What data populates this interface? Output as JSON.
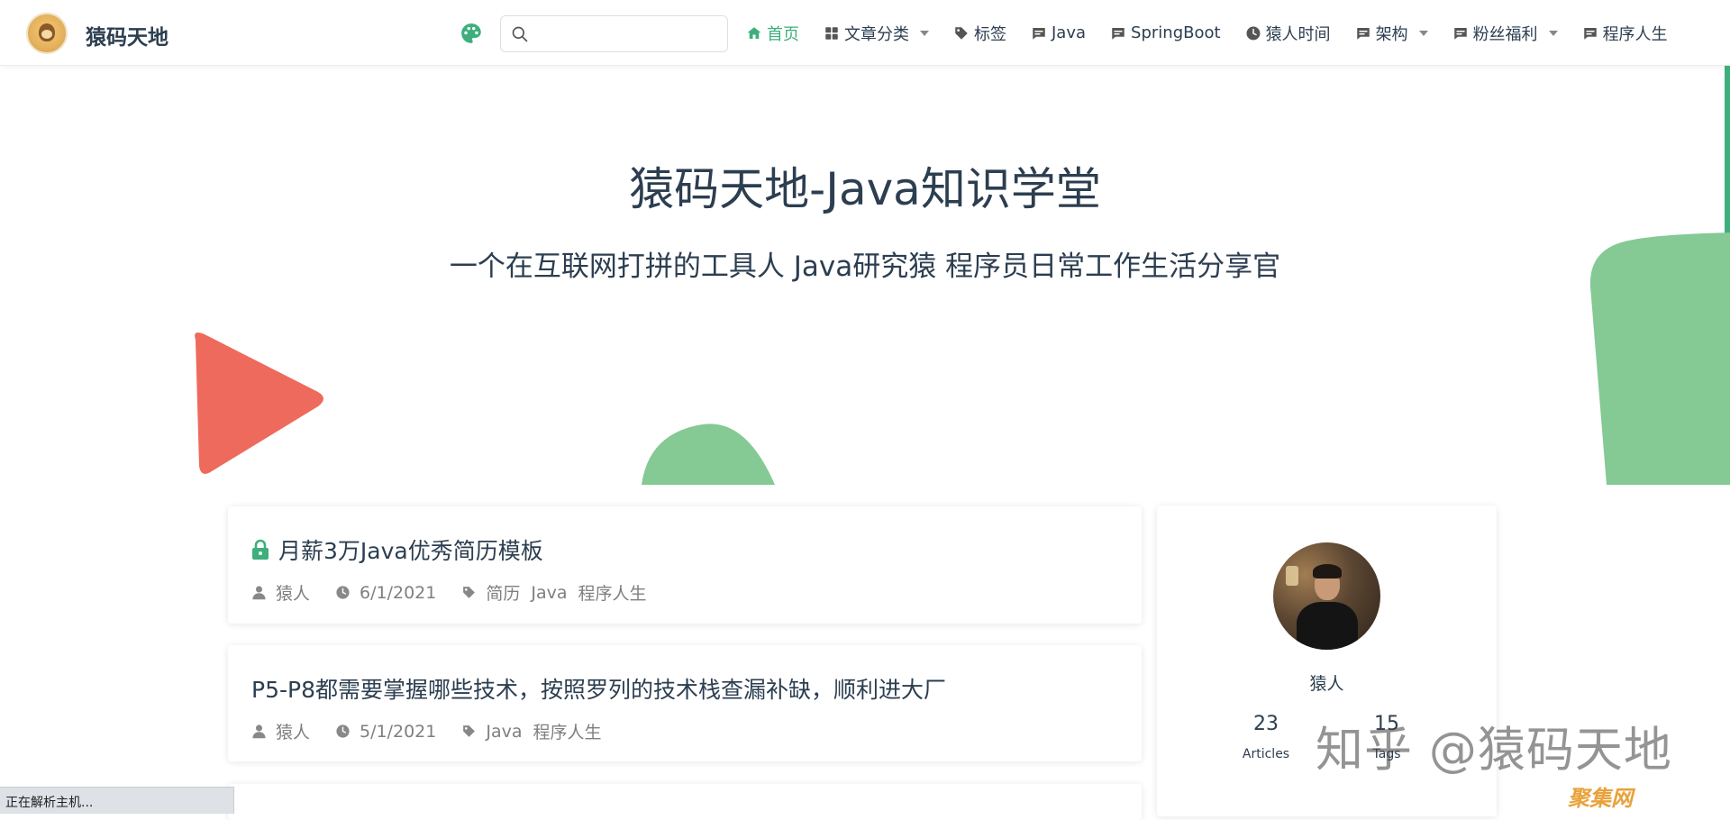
{
  "site": {
    "name": "猿码天地"
  },
  "search": {
    "placeholder": "",
    "value": ""
  },
  "nav": {
    "items": [
      {
        "label": "首页",
        "icon": "home-icon",
        "active": true,
        "dropdown": false
      },
      {
        "label": "文章分类",
        "icon": "grid-icon",
        "active": false,
        "dropdown": true
      },
      {
        "label": "标签",
        "icon": "tag-icon",
        "active": false,
        "dropdown": false
      },
      {
        "label": "Java",
        "icon": "message-icon",
        "active": false,
        "dropdown": false
      },
      {
        "label": "SpringBoot",
        "icon": "message-icon",
        "active": false,
        "dropdown": false
      },
      {
        "label": "猿人时间",
        "icon": "clock-icon",
        "active": false,
        "dropdown": false
      },
      {
        "label": "架构",
        "icon": "message-icon",
        "active": false,
        "dropdown": true
      },
      {
        "label": "粉丝福利",
        "icon": "message-icon",
        "active": false,
        "dropdown": true
      },
      {
        "label": "程序人生",
        "icon": "message-icon",
        "active": false,
        "dropdown": false
      }
    ]
  },
  "hero": {
    "title": "猿码天地-Java知识学堂",
    "subtitle": "一个在互联网打拼的工具人 Java研究猿 程序员日常工作生活分享官"
  },
  "posts": [
    {
      "title": "月薪3万Java优秀简历模板",
      "locked": true,
      "author": "猿人",
      "date": "6/1/2021",
      "tags": [
        "简历",
        "Java",
        "程序人生"
      ]
    },
    {
      "title": "P5-P8都需要掌握哪些技术，按照罗列的技术栈查漏补缺，顺利进大厂",
      "locked": false,
      "author": "猿人",
      "date": "5/1/2021",
      "tags": [
        "Java",
        "程序人生"
      ]
    }
  ],
  "profile": {
    "name": "猿人",
    "stats": [
      {
        "value": "23",
        "label": "Articles"
      },
      {
        "value": "",
        "label": ""
      },
      {
        "value": "15",
        "label": "Tags"
      }
    ]
  },
  "watermark": {
    "text": "知乎 @猿码天地",
    "secondary": "聚集网"
  },
  "status_bar": {
    "text": "正在解析主机..."
  },
  "colors": {
    "accent": "#3eaf7c",
    "triangle": "#ee6a5c",
    "blob": "#85c995",
    "text": "#2c3e50"
  }
}
